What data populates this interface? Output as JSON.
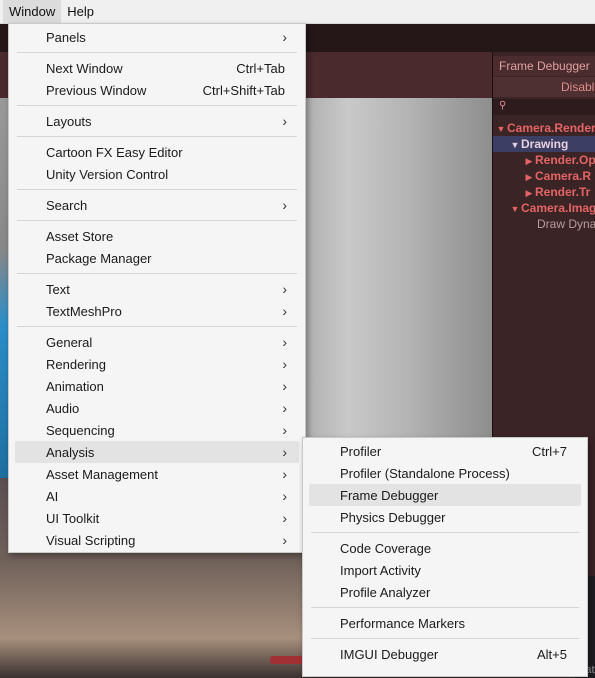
{
  "menubar": {
    "items": [
      {
        "label": "Window",
        "active": true
      },
      {
        "label": "Help",
        "active": false
      }
    ]
  },
  "window_menu": {
    "items": [
      {
        "label": "Panels",
        "submenu": true
      },
      {
        "label": "Next Window",
        "shortcut": "Ctrl+Tab"
      },
      {
        "label": "Previous Window",
        "shortcut": "Ctrl+Shift+Tab"
      },
      {
        "label": "Layouts",
        "submenu": true
      },
      {
        "label": "Cartoon FX Easy Editor"
      },
      {
        "label": "Unity Version Control"
      },
      {
        "label": "Search",
        "submenu": true
      },
      {
        "label": "Asset Store"
      },
      {
        "label": "Package Manager"
      },
      {
        "label": "Text",
        "submenu": true
      },
      {
        "label": "TextMeshPro",
        "submenu": true
      },
      {
        "label": "General",
        "submenu": true
      },
      {
        "label": "Rendering",
        "submenu": true
      },
      {
        "label": "Animation",
        "submenu": true
      },
      {
        "label": "Audio",
        "submenu": true
      },
      {
        "label": "Sequencing",
        "submenu": true
      },
      {
        "label": "Analysis",
        "submenu": true,
        "highlighted": true
      },
      {
        "label": "Asset Management",
        "submenu": true
      },
      {
        "label": "AI",
        "submenu": true
      },
      {
        "label": "UI Toolkit",
        "submenu": true
      },
      {
        "label": "Visual Scripting",
        "submenu": true
      }
    ]
  },
  "analysis_submenu": {
    "items": [
      {
        "label": "Profiler",
        "shortcut": "Ctrl+7"
      },
      {
        "label": "Profiler (Standalone Process)"
      },
      {
        "label": "Frame Debugger",
        "highlighted": true
      },
      {
        "label": "Physics Debugger"
      },
      {
        "label": "Code Coverage"
      },
      {
        "label": "Import Activity"
      },
      {
        "label": "Profile Analyzer"
      },
      {
        "label": "Performance Markers"
      },
      {
        "label": "IMGUI Debugger",
        "shortcut": "Alt+5"
      }
    ]
  },
  "frame_debugger": {
    "title": "Frame Debugger",
    "disable_button": "Disable",
    "tree": [
      {
        "label": "Camera.Render",
        "expanded": true
      },
      {
        "label": "Drawing",
        "expanded": true,
        "selected": true
      },
      {
        "label": "Render.Op",
        "expanded": false
      },
      {
        "label": "Camera.R",
        "expanded": false
      },
      {
        "label": "Render.Tr",
        "expanded": false
      },
      {
        "label": "Camera.Imag",
        "expanded": true
      },
      {
        "label": "Draw Dyna",
        "leaf": true
      }
    ]
  },
  "side_panel_fragments": [
    "Bat"
  ],
  "colors": {
    "menu_bg": "#f5f5f5",
    "menu_highlight": "#e3e3e3",
    "tree_text": "#e46464",
    "tree_selected_bg": "#3c3f63"
  }
}
